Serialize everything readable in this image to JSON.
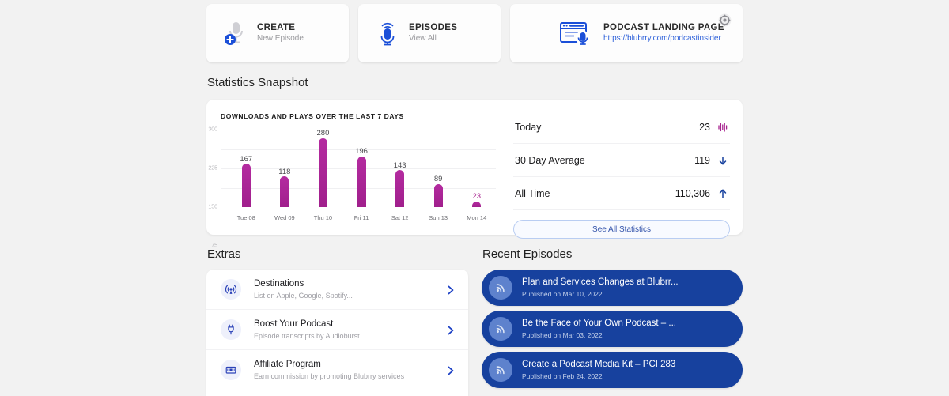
{
  "top_cards": [
    {
      "id": "create",
      "icon": "microphone-plus-icon",
      "title": "CREATE",
      "subtitle": "New Episode"
    },
    {
      "id": "episodes",
      "icon": "microphone-broadcast-icon",
      "title": "EPISODES",
      "subtitle": "View All"
    },
    {
      "id": "landing",
      "icon": "browser-microphone-icon",
      "title": "PODCAST LANDING PAGE",
      "subtitle": "https://blubrry.com/podcastinsider",
      "gear_icon": "gear-icon"
    }
  ],
  "sections": {
    "statistics_heading": "Statistics Snapshot",
    "extras_heading": "Extras",
    "recent_heading": "Recent Episodes"
  },
  "chart_data": {
    "type": "bar",
    "title": "DOWNLOADS AND PLAYS OVER THE LAST 7 DAYS",
    "categories": [
      "Tue 08",
      "Wed 09",
      "Thu 10",
      "Fri 11",
      "Sat 12",
      "Sun 13",
      "Mon 14"
    ],
    "values": [
      167,
      118,
      280,
      196,
      143,
      89,
      23
    ],
    "value_labels": [
      "167",
      "118",
      "280",
      "196",
      "143",
      "89",
      "23"
    ],
    "yticks": [
      300,
      225,
      150,
      75
    ],
    "ytick_labels": [
      "300",
      "225",
      "150",
      "75"
    ],
    "ylim": [
      0,
      300
    ],
    "xlabel": "",
    "ylabel": "",
    "grid": true,
    "legend": "none",
    "bar_color": "#a8238f",
    "highlight_index": 6
  },
  "stats": {
    "rows": [
      {
        "label": "Today",
        "value": "23",
        "icon": "waveform-icon",
        "icon_color": "#a8238f"
      },
      {
        "label": "30 Day Average",
        "value": "119",
        "icon": "arrow-down-icon",
        "icon_color": "#17419e"
      },
      {
        "label": "All Time",
        "value": "110,306",
        "icon": "arrow-up-icon",
        "icon_color": "#17419e"
      }
    ],
    "see_all_label": "See All Statistics"
  },
  "extras": [
    {
      "icon": "broadcast-antenna-icon",
      "title": "Destinations",
      "subtitle": "List on Apple, Google, Spotify...",
      "chevron": "chevron-right-icon"
    },
    {
      "icon": "power-plug-icon",
      "title": "Boost Your Podcast",
      "subtitle": "Episode transcripts by Audioburst",
      "chevron": "chevron-right-icon"
    },
    {
      "icon": "money-bill-icon",
      "title": "Affiliate Program",
      "subtitle": "Earn commission by promoting Blubrry services",
      "chevron": "chevron-right-icon"
    }
  ],
  "recent_episodes": [
    {
      "icon": "rss-icon",
      "title": "Plan and Services Changes at Blubrr...",
      "published": "Published on Mar 10, 2022"
    },
    {
      "icon": "rss-icon",
      "title": "Be the Face of Your Own Podcast – ...",
      "published": "Published on Mar 03, 2022"
    },
    {
      "icon": "rss-icon",
      "title": "Create a Podcast Media Kit – PCI 283",
      "published": "Published on Feb 24, 2022"
    }
  ],
  "colors": {
    "page_bg": "#f2f2f2",
    "brand_blue": "#17419e",
    "accent_magenta": "#a8238f",
    "link_blue": "#2b5fd9"
  }
}
